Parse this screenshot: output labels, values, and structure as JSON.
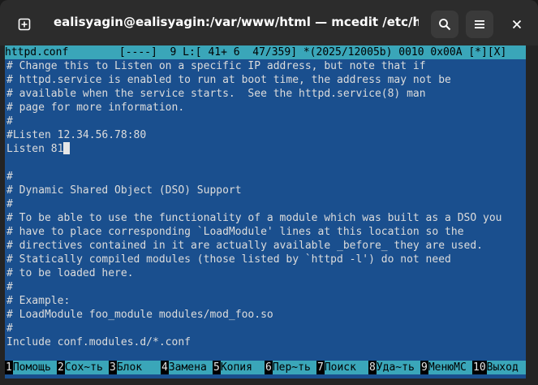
{
  "window": {
    "title": "ealisyagin@ealisyagin:/var/www/html — mcedit /etc/httpd/con…"
  },
  "icons": {
    "new_tab": "plus-in-box-icon",
    "search": "magnifier-icon",
    "menu": "hamburger-icon",
    "close": "x-icon"
  },
  "editor": {
    "status_line": "httpd.conf        [----]  9 L:[ 41+ 6  47/359] *(2025/12005b) 0010 0x00A [*][X]",
    "lines": [
      "# Change this to Listen on a specific IP address, but note that if",
      "# httpd.service is enabled to run at boot time, the address may not be",
      "# available when the service starts.  See the httpd.service(8) man",
      "# page for more information.",
      "#",
      "#Listen 12.34.56.78:80",
      "Listen 81",
      "",
      "#",
      "# Dynamic Shared Object (DSO) Support",
      "#",
      "# To be able to use the functionality of a module which was built as a DSO you",
      "# have to place corresponding `LoadModule' lines at this location so the",
      "# directives contained in it are actually available _before_ they are used.",
      "# Statically compiled modules (those listed by `httpd -l') do not need",
      "# to be loaded here.",
      "#",
      "# Example:",
      "# LoadModule foo_module modules/mod_foo.so",
      "#",
      "Include conf.modules.d/*.conf",
      ""
    ],
    "cursor_line_index": 6
  },
  "function_keys": [
    {
      "num": "1",
      "label": "Помощь"
    },
    {
      "num": "2",
      "label": "Сох~ть"
    },
    {
      "num": "3",
      "label": "Блок"
    },
    {
      "num": "4",
      "label": "Замена"
    },
    {
      "num": "5",
      "label": "Копия"
    },
    {
      "num": "6",
      "label": "Пер~ть"
    },
    {
      "num": "7",
      "label": "Поиск"
    },
    {
      "num": "8",
      "label": "Уда~ть"
    },
    {
      "num": "9",
      "label": "МенюМС"
    },
    {
      "num": "10",
      "label": "Выход"
    }
  ],
  "colors": {
    "editor_bg": "#1a4f8e",
    "status_bg": "#3aa6b9",
    "titlebar_bg": "#2c2c2c"
  }
}
